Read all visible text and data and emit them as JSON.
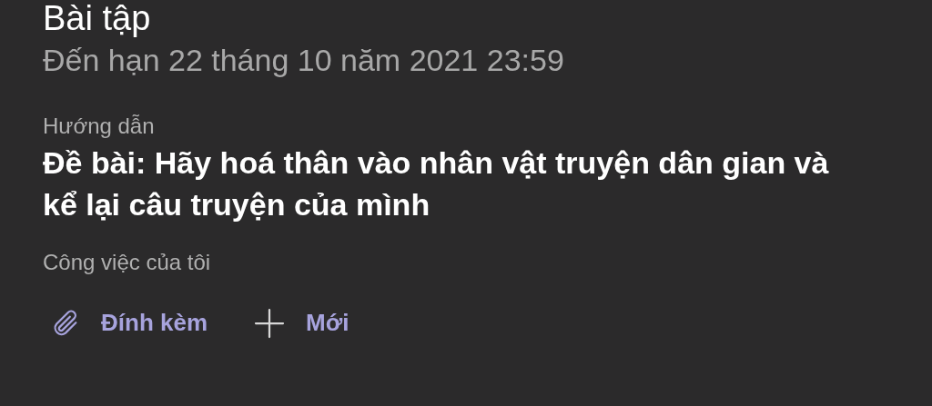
{
  "title": "Bài tập",
  "due": "Đến hạn 22 tháng 10 năm 2021 23:59",
  "instructions": {
    "label": "Hướng dẫn",
    "text": "Đề bài: Hãy hoá thân vào nhân vật truyện dân gian và kể lại câu truyện của mình"
  },
  "my_work": {
    "label": "Công việc của tôi"
  },
  "actions": [
    {
      "kind": "attach",
      "label": "Đính kèm"
    },
    {
      "kind": "new",
      "label": "Mới"
    }
  ]
}
